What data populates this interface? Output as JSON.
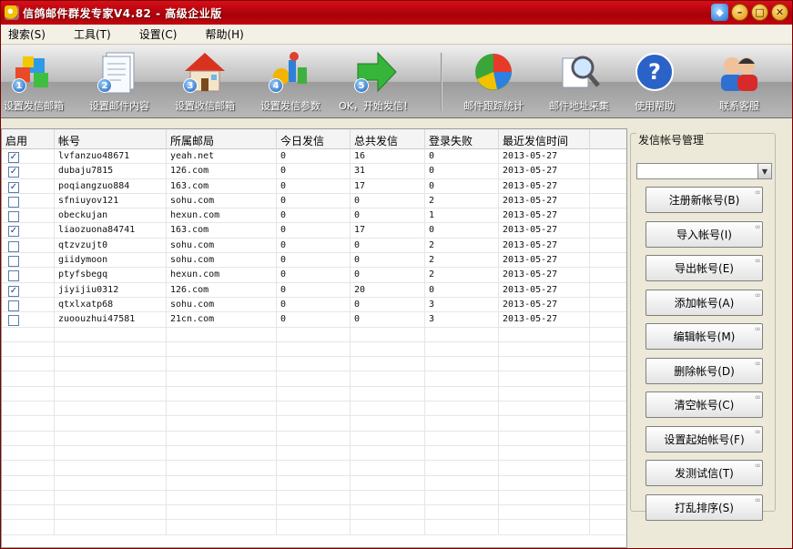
{
  "window": {
    "title": "信鸽邮件群发专家V4.82 - 高级企业版"
  },
  "menu": [
    "搜索(S)",
    "工具(T)",
    "设置(C)",
    "帮助(H)"
  ],
  "toolbar": [
    {
      "label": "设置发信邮箱",
      "num": "1",
      "icon": "blocks-icon"
    },
    {
      "label": "设置邮件内容",
      "num": "2",
      "icon": "document-icon"
    },
    {
      "label": "设置收信邮箱",
      "num": "3",
      "icon": "house-icon"
    },
    {
      "label": "设置发信参数",
      "num": "4",
      "icon": "parameters-icon"
    },
    {
      "label": "OK，开始发信！",
      "num": "5",
      "icon": "arrow-right-icon"
    },
    {
      "label": "邮件跟踪统计",
      "icon": "pie-chart-icon"
    },
    {
      "label": "邮件地址采集",
      "icon": "magnifier-icon"
    },
    {
      "label": "使用帮助",
      "icon": "help-icon"
    },
    {
      "label": "联系客服",
      "icon": "support-icon"
    }
  ],
  "table": {
    "headers": [
      "启用",
      "帐号",
      "所属邮局",
      "今日发信",
      "总共发信",
      "登录失败",
      "最近发信时间"
    ],
    "rows": [
      {
        "enabled": true,
        "account": "lvfanzuo48671",
        "domain": "yeah.net",
        "today": "0",
        "total": "16",
        "fail": "0",
        "last": "2013-05-27"
      },
      {
        "enabled": true,
        "account": "dubaju7815",
        "domain": "126.com",
        "today": "0",
        "total": "31",
        "fail": "0",
        "last": "2013-05-27"
      },
      {
        "enabled": true,
        "account": "poqiangzuo884",
        "domain": "163.com",
        "today": "0",
        "total": "17",
        "fail": "0",
        "last": "2013-05-27"
      },
      {
        "enabled": false,
        "account": "sfniuyov121",
        "domain": "sohu.com",
        "today": "0",
        "total": "0",
        "fail": "2",
        "last": "2013-05-27"
      },
      {
        "enabled": false,
        "account": "obeckujan",
        "domain": "hexun.com",
        "today": "0",
        "total": "0",
        "fail": "1",
        "last": "2013-05-27"
      },
      {
        "enabled": true,
        "account": "liaozuona84741",
        "domain": "163.com",
        "today": "0",
        "total": "17",
        "fail": "0",
        "last": "2013-05-27"
      },
      {
        "enabled": false,
        "account": "qtzvzujt0",
        "domain": "sohu.com",
        "today": "0",
        "total": "0",
        "fail": "2",
        "last": "2013-05-27"
      },
      {
        "enabled": false,
        "account": "giidymoon",
        "domain": "sohu.com",
        "today": "0",
        "total": "0",
        "fail": "2",
        "last": "2013-05-27"
      },
      {
        "enabled": false,
        "account": "ptyfsbegq",
        "domain": "hexun.com",
        "today": "0",
        "total": "0",
        "fail": "2",
        "last": "2013-05-27"
      },
      {
        "enabled": true,
        "account": "jiyijiu0312",
        "domain": "126.com",
        "today": "0",
        "total": "20",
        "fail": "0",
        "last": "2013-05-27"
      },
      {
        "enabled": false,
        "account": "qtxlxatp68",
        "domain": "sohu.com",
        "today": "0",
        "total": "0",
        "fail": "3",
        "last": "2013-05-27"
      },
      {
        "enabled": false,
        "account": "zuoouzhui47581",
        "domain": "21cn.com",
        "today": "0",
        "total": "0",
        "fail": "3",
        "last": "2013-05-27"
      }
    ],
    "empty_rows": 14
  },
  "side": {
    "title": "发信帐号管理",
    "combo_value": "",
    "buttons": [
      "注册新帐号(B)",
      "导入帐号(I)",
      "导出帐号(E)",
      "添加帐号(A)",
      "编辑帐号(M)",
      "删除帐号(D)",
      "清空帐号(C)",
      "设置起始帐号(F)",
      "发测试信(T)",
      "打乱排序(S)"
    ]
  }
}
